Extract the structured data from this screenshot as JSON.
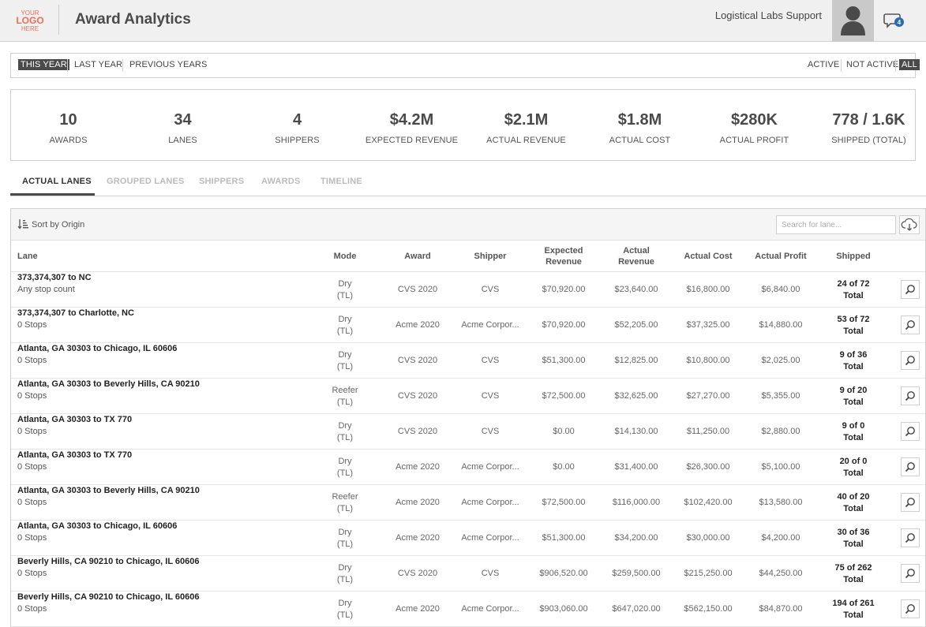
{
  "header": {
    "logo": {
      "line1": "YOUR",
      "line2": "LOGO",
      "line3": "HERE"
    },
    "title": "Award Analytics",
    "support_label": "Logistical Labs Support",
    "chat_badge": "4"
  },
  "filters": {
    "period": [
      "THIS YEAR",
      "LAST YEAR",
      "PREVIOUS YEARS"
    ],
    "status": [
      "ACTIVE",
      "NOT ACTIVE",
      "ALL"
    ],
    "period_selected": "THIS YEAR",
    "status_selected": "ALL"
  },
  "stats": [
    {
      "value": "10",
      "label": "AWARDS"
    },
    {
      "value": "34",
      "label": "LANES"
    },
    {
      "value": "4",
      "label": "SHIPPERS"
    },
    {
      "value": "$4.2M",
      "label": "EXPECTED REVENUE"
    },
    {
      "value": "$2.1M",
      "label": "ACTUAL REVENUE"
    },
    {
      "value": "$1.8M",
      "label": "ACTUAL COST"
    },
    {
      "value": "$280K",
      "label": "ACTUAL PROFIT"
    },
    {
      "value": "778 / 1.6K",
      "label": "SHIPPED (TOTAL)"
    }
  ],
  "tabs": [
    "ACTUAL LANES",
    "GROUPED LANES",
    "SHIPPERS",
    "AWARDS",
    "TIMELINE"
  ],
  "active_tab": "ACTUAL LANES",
  "toolbar": {
    "sort_label": "Sort by Origin",
    "search_placeholder": "Search for lane..."
  },
  "columns": {
    "lane": "Lane",
    "mode": "Mode",
    "award": "Award",
    "shipper": "Shipper",
    "expected_revenue_1": "Expected",
    "expected_revenue_2": "Revenue",
    "actual_revenue_1": "Actual",
    "actual_revenue_2": "Revenue",
    "actual_cost": "Actual Cost",
    "actual_profit": "Actual Profit",
    "shipped": "Shipped"
  },
  "rows": [
    {
      "lane": "373,374,307 to NC",
      "stops": "Any stop count",
      "mode": "Dry",
      "mode_sub": "(TL)",
      "award": "CVS 2020",
      "shipper": "CVS",
      "expected": "$70,920.00",
      "actual_rev": "$23,640.00",
      "cost": "$16,800.00",
      "profit": "$6,840.00",
      "shipped": "24 of 72",
      "shipped_sub": "Total"
    },
    {
      "lane": "373,374,307 to Charlotte, NC",
      "stops": "0 Stops",
      "mode": "Dry",
      "mode_sub": "(TL)",
      "award": "Acme 2020",
      "shipper": "Acme Corpor...",
      "expected": "$70,920.00",
      "actual_rev": "$52,205.00",
      "cost": "$37,325.00",
      "profit": "$14,880.00",
      "shipped": "53 of 72",
      "shipped_sub": "Total"
    },
    {
      "lane": "Atlanta, GA 30303 to Chicago, IL 60606",
      "stops": "0 Stops",
      "mode": "Dry",
      "mode_sub": "(TL)",
      "award": "CVS 2020",
      "shipper": "CVS",
      "expected": "$51,300.00",
      "actual_rev": "$12,825.00",
      "cost": "$10,800.00",
      "profit": "$2,025.00",
      "shipped": "9 of 36",
      "shipped_sub": "Total"
    },
    {
      "lane": "Atlanta, GA 30303 to Beverly Hills, CA 90210",
      "stops": "0 Stops",
      "mode": "Reefer",
      "mode_sub": "(TL)",
      "award": "CVS 2020",
      "shipper": "CVS",
      "expected": "$72,500.00",
      "actual_rev": "$32,625.00",
      "cost": "$27,270.00",
      "profit": "$5,355.00",
      "shipped": "9 of 20",
      "shipped_sub": "Total"
    },
    {
      "lane": "Atlanta, GA 30303 to TX 770",
      "stops": "0 Stops",
      "mode": "Dry",
      "mode_sub": "(TL)",
      "award": "CVS 2020",
      "shipper": "CVS",
      "expected": "$0.00",
      "actual_rev": "$14,130.00",
      "cost": "$11,250.00",
      "profit": "$2,880.00",
      "shipped": "9 of 0",
      "shipped_sub": "Total"
    },
    {
      "lane": "Atlanta, GA 30303 to TX 770",
      "stops": "0 Stops",
      "mode": "Dry",
      "mode_sub": "(TL)",
      "award": "Acme 2020",
      "shipper": "Acme Corpor...",
      "expected": "$0.00",
      "actual_rev": "$31,400.00",
      "cost": "$26,300.00",
      "profit": "$5,100.00",
      "shipped": "20 of 0",
      "shipped_sub": "Total"
    },
    {
      "lane": "Atlanta, GA 30303 to Beverly Hills, CA 90210",
      "stops": "0 Stops",
      "mode": "Reefer",
      "mode_sub": "(TL)",
      "award": "Acme 2020",
      "shipper": "Acme Corpor...",
      "expected": "$72,500.00",
      "actual_rev": "$116,000.00",
      "cost": "$102,420.00",
      "profit": "$13,580.00",
      "shipped": "40 of 20",
      "shipped_sub": "Total"
    },
    {
      "lane": "Atlanta, GA 30303 to Chicago, IL 60606",
      "stops": "0 Stops",
      "mode": "Dry",
      "mode_sub": "(TL)",
      "award": "Acme 2020",
      "shipper": "Acme Corpor...",
      "expected": "$51,300.00",
      "actual_rev": "$34,200.00",
      "cost": "$30,000.00",
      "profit": "$4,200.00",
      "shipped": "30 of 36",
      "shipped_sub": "Total"
    },
    {
      "lane": "Beverly Hills, CA 90210 to Chicago, IL 60606",
      "stops": "0 Stops",
      "mode": "Dry",
      "mode_sub": "(TL)",
      "award": "CVS 2020",
      "shipper": "CVS",
      "expected": "$906,520.00",
      "actual_rev": "$259,500.00",
      "cost": "$215,250.00",
      "profit": "$44,250.00",
      "shipped": "75 of 262",
      "shipped_sub": "Total"
    },
    {
      "lane": "Beverly Hills, CA 90210 to Chicago, IL 60606",
      "stops": "0 Stops",
      "mode": "Dry",
      "mode_sub": "(TL)",
      "award": "Acme 2020",
      "shipper": "Acme Corpor...",
      "expected": "$903,060.00",
      "actual_rev": "$647,020.00",
      "cost": "$562,150.00",
      "profit": "$84,870.00",
      "shipped": "194 of 261",
      "shipped_sub": "Total"
    }
  ],
  "colors": {
    "logo": "#e9705b",
    "active_chip": "#4a4a4a",
    "badge": "#2b6cb0"
  },
  "icons": {
    "avatar": "user-silhouette-icon",
    "chat": "chat-bubble-icon",
    "sort": "sort-descending-icon",
    "cloud": "cloud-download-icon",
    "magnifier": "magnifier-icon"
  }
}
